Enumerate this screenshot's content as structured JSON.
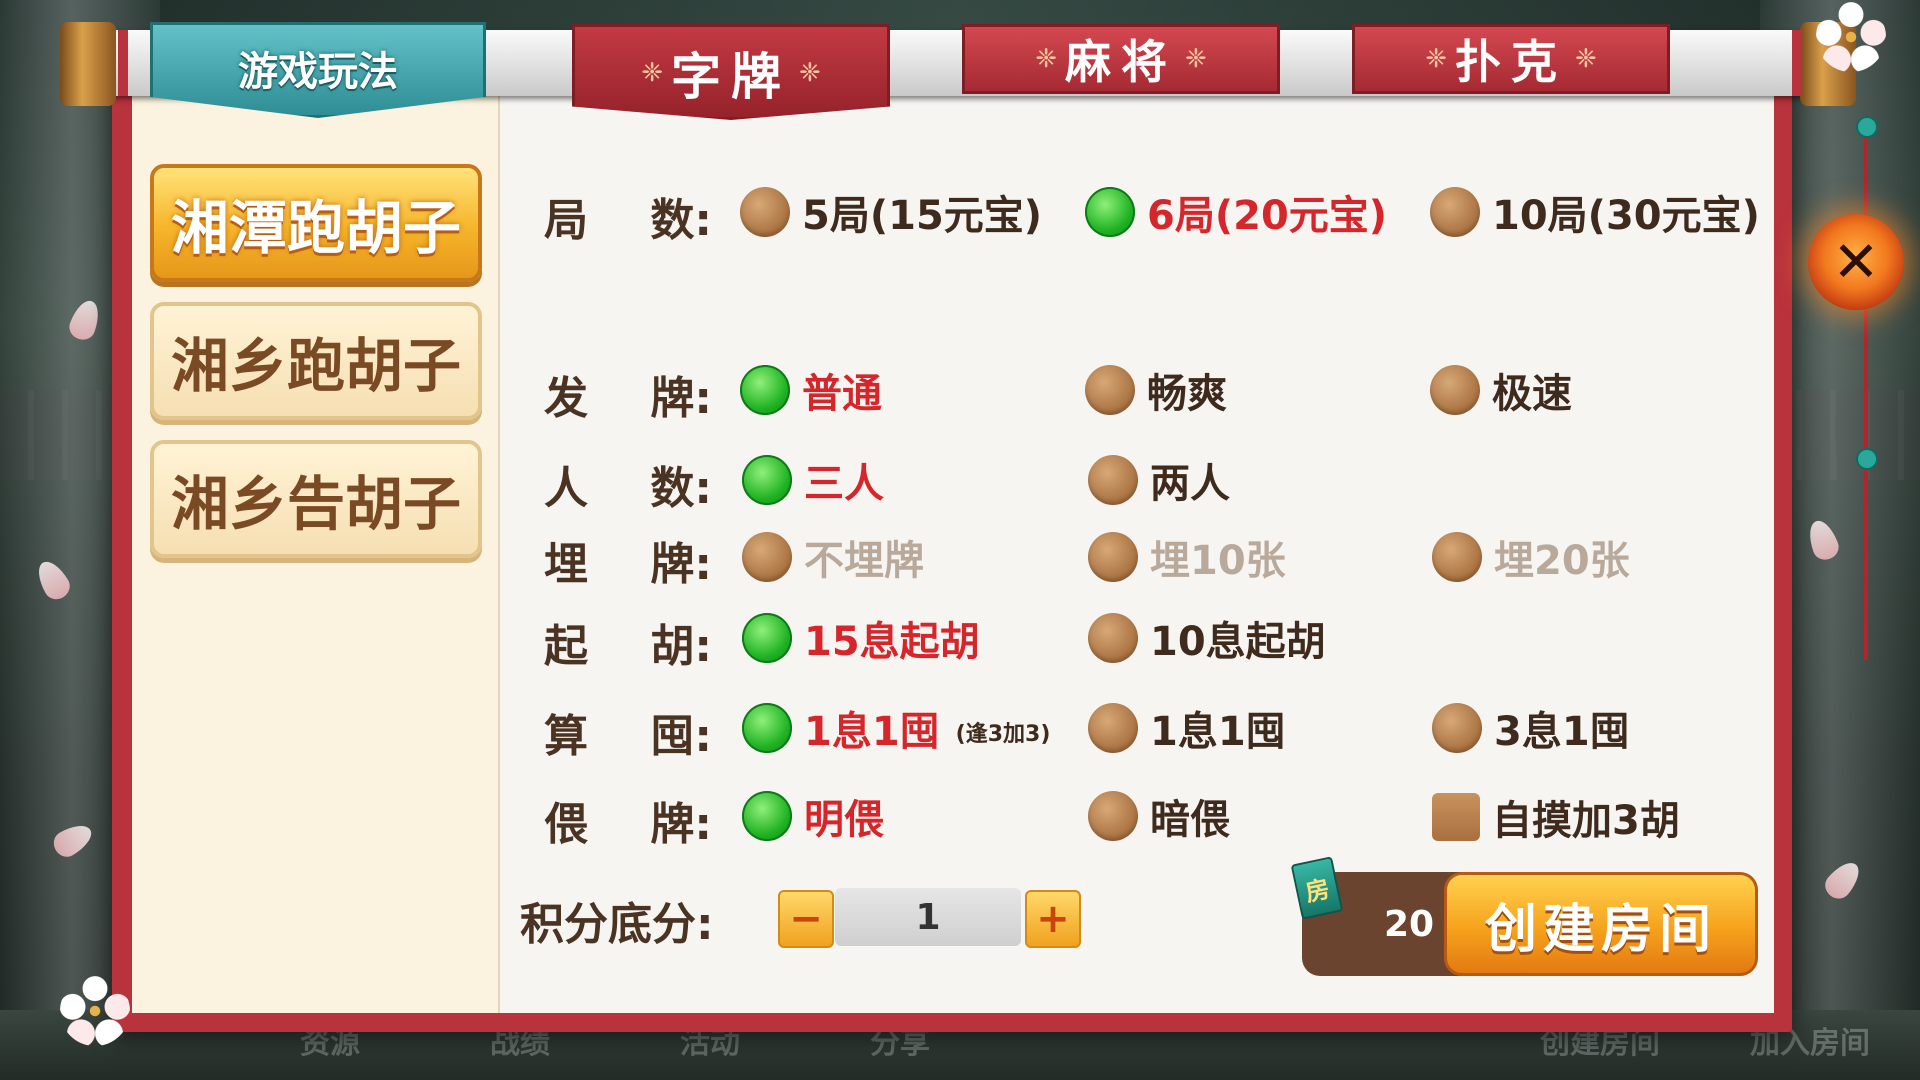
{
  "header": {
    "rules_tab": "游戏玩法",
    "tabs": [
      {
        "label": "字牌",
        "active": true
      },
      {
        "label": "麻将",
        "active": false
      },
      {
        "label": "扑克",
        "active": false
      }
    ]
  },
  "sidebar": {
    "games": [
      {
        "label": "湘潭跑胡子",
        "selected": true
      },
      {
        "label": "湘乡跑胡子",
        "selected": false
      },
      {
        "label": "湘乡告胡子",
        "selected": false
      }
    ]
  },
  "options": {
    "rounds": {
      "label_a": "局",
      "label_b": "数:",
      "choices": [
        "5局(15元宝)",
        "6局(20元宝)",
        "10局(30元宝)"
      ],
      "selected": 1
    },
    "deal": {
      "label_a": "发",
      "label_b": "牌:",
      "choices": [
        "普通",
        "畅爽",
        "极速"
      ],
      "selected": 0
    },
    "players": {
      "label_a": "人",
      "label_b": "数:",
      "choices": [
        "三人",
        "两人"
      ],
      "selected": 0
    },
    "bury": {
      "label_a": "埋",
      "label_b": "牌:",
      "choices": [
        "不埋牌",
        "埋10张",
        "埋20张"
      ],
      "disabled": true
    },
    "start_hu": {
      "label_a": "起",
      "label_b": "胡:",
      "choices": [
        "15息起胡",
        "10息起胡"
      ],
      "selected": 0
    },
    "calc": {
      "label_a": "算",
      "label_b": "囤:",
      "choices": [
        "1息1囤",
        "1息1囤",
        "3息1囤"
      ],
      "note": "(逢3加3)",
      "selected": 0
    },
    "wei": {
      "label_a": "偎",
      "label_b": "牌:",
      "choices": [
        "明偎",
        "暗偎"
      ],
      "selected": 0,
      "extra_checkbox": "自摸加3胡"
    }
  },
  "score": {
    "label": "积分底分:",
    "minus": "−",
    "plus": "+",
    "value": "1"
  },
  "create": {
    "card_icon_text": "房",
    "cost": "20",
    "button": "创建房间"
  },
  "close": {
    "symbol": "✕"
  },
  "background": {
    "bottom_items": [
      "资源",
      "战绩",
      "活动",
      "分享",
      "创建房间",
      "加入房间"
    ]
  }
}
